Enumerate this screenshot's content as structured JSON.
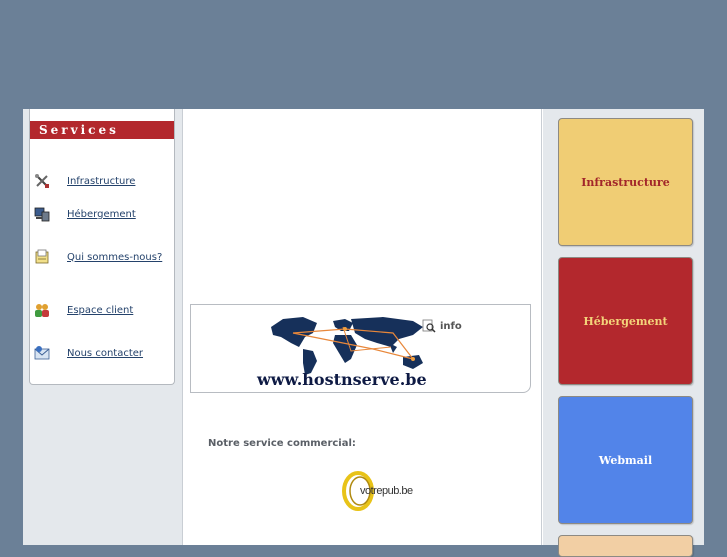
{
  "colors": {
    "background": "#6b8097",
    "services_header": "#b3282d",
    "tile_infrastructure": "#f0cd74",
    "tile_hebergement": "#b3282d",
    "tile_webmail": "#5284e9",
    "tile_partial": "#f2cfa4"
  },
  "sidebar": {
    "title": "Services",
    "items": [
      {
        "label": "Infrastructure",
        "icon": "tools-icon"
      },
      {
        "label": "Hébergement",
        "icon": "server-icon"
      },
      {
        "label": "Qui sommes-nous?",
        "icon": "document-icon"
      },
      {
        "label": "Espace client",
        "icon": "users-icon"
      },
      {
        "label": "Nous contacter",
        "icon": "mail-icon"
      }
    ]
  },
  "banner": {
    "url": "www.hostnserve.be",
    "info_label": "info"
  },
  "main": {
    "commercial_label": "Notre service commercial:",
    "partner_logo": "votrepub.be"
  },
  "tiles": [
    {
      "label": "Infrastructure"
    },
    {
      "label": "Hébergement"
    },
    {
      "label": "Webmail"
    }
  ]
}
